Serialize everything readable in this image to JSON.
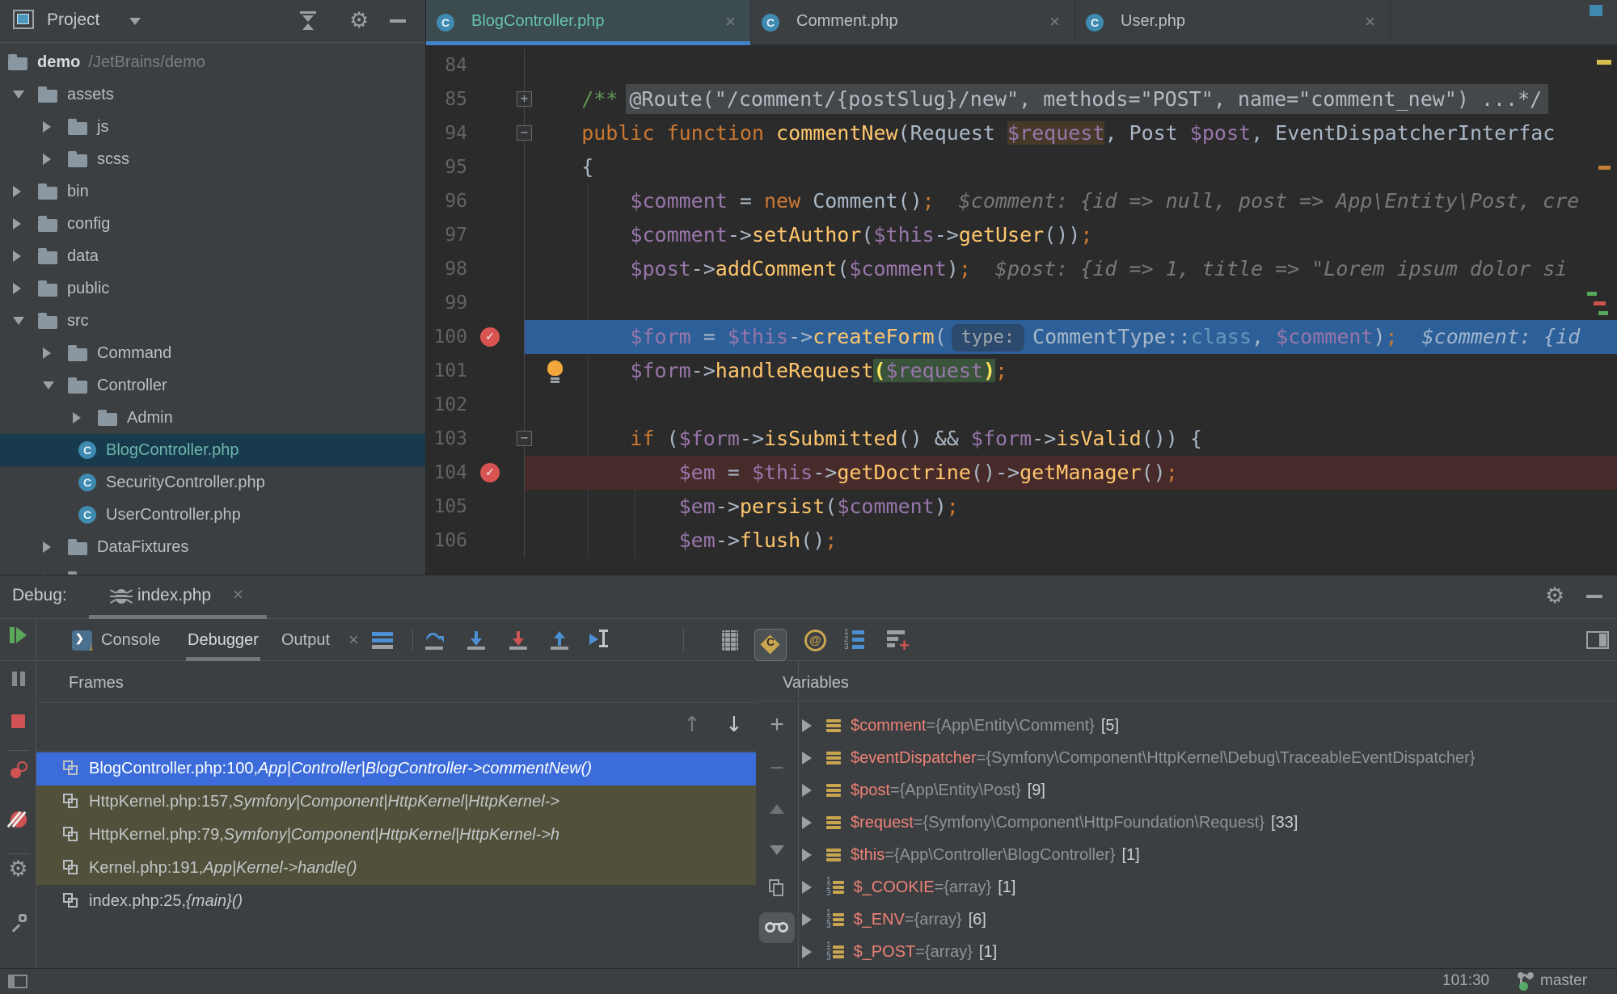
{
  "colors": {
    "panel_bg": "#3c3f41",
    "editor_bg": "#2b2b2b",
    "execution_line": "#2d6099",
    "breakpoint_line": "#472a2a",
    "frame_selected": "#3b6cd9",
    "frame_library": "#51503a",
    "active_tab_accent": "#4083c9",
    "active_tab_text": "#66c2b0",
    "breakpoint_red": "#d75452",
    "variable_name": "#ee8277"
  },
  "icons": {
    "close": "×",
    "gear": "⚙",
    "up_arrow": "↑",
    "down_arrow": "↓",
    "check": "✓",
    "fold_plus": "+",
    "fold_minus": "−",
    "minus": "−",
    "plus": "+"
  },
  "project": {
    "title": "Project",
    "tree": [
      {
        "label": "demo",
        "suffix": "/JetBrains/demo",
        "level": 0,
        "icon": "folder",
        "root": true
      },
      {
        "label": "assets",
        "level": 0,
        "arrow": "down",
        "icon": "folder"
      },
      {
        "label": "js",
        "level": 1,
        "arrow": "right",
        "icon": "folder"
      },
      {
        "label": "scss",
        "level": 1,
        "arrow": "right",
        "icon": "folder"
      },
      {
        "label": "bin",
        "level": 0,
        "arrow": "right",
        "icon": "folder"
      },
      {
        "label": "config",
        "level": 0,
        "arrow": "right",
        "icon": "folder"
      },
      {
        "label": "data",
        "level": 0,
        "arrow": "right",
        "icon": "folder"
      },
      {
        "label": "public",
        "level": 0,
        "arrow": "right",
        "icon": "folder"
      },
      {
        "label": "src",
        "level": 0,
        "arrow": "down",
        "icon": "folder"
      },
      {
        "label": "Command",
        "level": 1,
        "arrow": "right",
        "icon": "folder"
      },
      {
        "label": "Controller",
        "level": 1,
        "arrow": "down",
        "icon": "folder"
      },
      {
        "label": "Admin",
        "level": 2,
        "arrow": "right",
        "icon": "folder"
      },
      {
        "label": "BlogController.php",
        "level": 2,
        "icon": "php",
        "file": true,
        "selected": true
      },
      {
        "label": "SecurityController.php",
        "level": 2,
        "icon": "php",
        "file": true
      },
      {
        "label": "UserController.php",
        "level": 2,
        "icon": "php",
        "file": true
      },
      {
        "label": "DataFixtures",
        "level": 1,
        "arrow": "right",
        "icon": "folder"
      },
      {
        "label": "",
        "level": 1,
        "arrow": "right",
        "icon": "folder"
      }
    ]
  },
  "tabs": [
    {
      "name": "BlogController.php",
      "active": true
    },
    {
      "name": "Comment.php",
      "active": false
    },
    {
      "name": "User.php",
      "active": false
    }
  ],
  "editor": {
    "lines": [
      {
        "n": 84,
        "t": []
      },
      {
        "n": 85,
        "g": "fold+",
        "t": [
          [
            "cmt",
            "    /**"
          ],
          [
            "fold",
            "@Route(\"/comment/{postSlug}/new\", methods=\"POST\", name=\"comment_new\") ...*/"
          ]
        ]
      },
      {
        "n": 94,
        "g": "fold-",
        "t": [
          [
            "k",
            "    public function "
          ],
          [
            "f",
            "commentNew"
          ],
          [
            "d",
            "(Request "
          ],
          [
            "vocc",
            "$request"
          ],
          [
            "d",
            ", Post "
          ],
          [
            "v",
            "$post"
          ],
          [
            "d",
            ", EventDispatcherInterfac"
          ]
        ]
      },
      {
        "n": 95,
        "t": [
          [
            "d",
            "    {"
          ]
        ]
      },
      {
        "n": 96,
        "t": [
          [
            "v",
            "        $comment"
          ],
          [
            "d",
            " = "
          ],
          [
            "k",
            "new"
          ],
          [
            "d",
            " Comment()"
          ],
          [
            "k",
            ";"
          ],
          [
            "hint",
            "$comment: {id => null, post => App\\Entity\\Post, cre"
          ]
        ]
      },
      {
        "n": 97,
        "t": [
          [
            "v",
            "        $comment"
          ],
          [
            "d",
            "->"
          ],
          [
            "f",
            "setAuthor"
          ],
          [
            "d",
            "("
          ],
          [
            "v",
            "$this"
          ],
          [
            "d",
            "->"
          ],
          [
            "f",
            "getUser"
          ],
          [
            "d",
            "())"
          ],
          [
            "k",
            ";"
          ]
        ]
      },
      {
        "n": 98,
        "t": [
          [
            "v",
            "        $post"
          ],
          [
            "d",
            "->"
          ],
          [
            "f",
            "addComment"
          ],
          [
            "d",
            "("
          ],
          [
            "v",
            "$comment"
          ],
          [
            "d",
            ")"
          ],
          [
            "k",
            ";"
          ],
          [
            "hint",
            "$post: {id => 1, title => \"Lorem ipsum dolor si"
          ]
        ]
      },
      {
        "n": 99,
        "t": []
      },
      {
        "n": 100,
        "g": "bp",
        "bg": "exec",
        "t": [
          [
            "v",
            "        $form"
          ],
          [
            "d",
            " = "
          ],
          [
            "v",
            "$this"
          ],
          [
            "d",
            "->"
          ],
          [
            "f",
            "createForm"
          ],
          [
            "d",
            "("
          ],
          [
            "chip",
            "type:"
          ],
          [
            "d",
            "CommentType::"
          ],
          [
            "b",
            "class"
          ],
          [
            "d",
            ", "
          ],
          [
            "v",
            "$comment"
          ],
          [
            "d",
            ")"
          ],
          [
            "k",
            ";"
          ],
          [
            "hint",
            "$comment: {id"
          ]
        ]
      },
      {
        "n": 101,
        "g": "bulb",
        "t": [
          [
            "v",
            "        $form"
          ],
          [
            "d",
            "->"
          ],
          [
            "f",
            "handleRequest"
          ],
          [
            "selp",
            "("
          ],
          [
            "selv",
            "$request"
          ],
          [
            "selp",
            ")"
          ],
          [
            "k",
            ";"
          ]
        ]
      },
      {
        "n": 102,
        "t": []
      },
      {
        "n": 103,
        "g": "fold-",
        "t": [
          [
            "k",
            "        if "
          ],
          [
            "d",
            "("
          ],
          [
            "v",
            "$form"
          ],
          [
            "d",
            "->"
          ],
          [
            "f",
            "isSubmitted"
          ],
          [
            "d",
            "() && "
          ],
          [
            "v",
            "$form"
          ],
          [
            "d",
            "->"
          ],
          [
            "f",
            "isValid"
          ],
          [
            "d",
            "()) {"
          ]
        ]
      },
      {
        "n": 104,
        "g": "bp",
        "bg": "bpline",
        "t": [
          [
            "v",
            "            $em"
          ],
          [
            "d",
            " = "
          ],
          [
            "v",
            "$this"
          ],
          [
            "d",
            "->"
          ],
          [
            "f",
            "getDoctrine"
          ],
          [
            "d",
            "()->"
          ],
          [
            "f",
            "getManager"
          ],
          [
            "d",
            "()"
          ],
          [
            "k",
            ";"
          ]
        ]
      },
      {
        "n": 105,
        "t": [
          [
            "v",
            "            $em"
          ],
          [
            "d",
            "->"
          ],
          [
            "f",
            "persist"
          ],
          [
            "d",
            "("
          ],
          [
            "v",
            "$comment"
          ],
          [
            "d",
            ")"
          ],
          [
            "k",
            ";"
          ]
        ]
      },
      {
        "n": 106,
        "t": [
          [
            "v",
            "            $em"
          ],
          [
            "d",
            "->"
          ],
          [
            "f",
            "flush"
          ],
          [
            "d",
            "()"
          ],
          [
            "k",
            ";"
          ]
        ]
      }
    ]
  },
  "debug": {
    "label": "Debug:",
    "session": "index.php",
    "tabs": [
      "Console",
      "Debugger",
      "Output"
    ],
    "active_tab": "Debugger"
  },
  "frames": {
    "title": "Frames",
    "rows": [
      {
        "file": "BlogController.php:100, ",
        "method": "App|Controller|BlogController->commentNew()",
        "selected": true
      },
      {
        "file": "HttpKernel.php:157, ",
        "method": "Symfony|Component|HttpKernel|HttpKernel->",
        "lib": true
      },
      {
        "file": "HttpKernel.php:79, ",
        "method": "Symfony|Component|HttpKernel|HttpKernel->h",
        "lib": true
      },
      {
        "file": "Kernel.php:191, ",
        "method": "App|Kernel->handle()",
        "lib": true
      },
      {
        "file": "index.php:25, ",
        "method": "{main}()"
      }
    ]
  },
  "variables": {
    "title": "Variables",
    "rows": [
      {
        "name": "$comment",
        "type": "{App\\Entity\\Comment}",
        "count": "[5]"
      },
      {
        "name": "$eventDispatcher",
        "type": "{Symfony\\Component\\HttpKernel\\Debug\\TraceableEventDispatcher}",
        "count": ""
      },
      {
        "name": "$post",
        "type": "{App\\Entity\\Post}",
        "count": "[9]"
      },
      {
        "name": "$request",
        "type": "{Symfony\\Component\\HttpFoundation\\Request}",
        "count": "[33]"
      },
      {
        "name": "$this",
        "type": "{App\\Controller\\BlogController}",
        "count": "[1]"
      },
      {
        "name": "$_COOKIE",
        "type": "{array}",
        "count": "[1]",
        "array": true
      },
      {
        "name": "$_ENV",
        "type": "{array}",
        "count": "[6]",
        "array": true
      },
      {
        "name": "$_POST",
        "type": "{array}",
        "count": "[1]",
        "array": true
      }
    ]
  },
  "status": {
    "position": "101:30",
    "branch": "master"
  }
}
